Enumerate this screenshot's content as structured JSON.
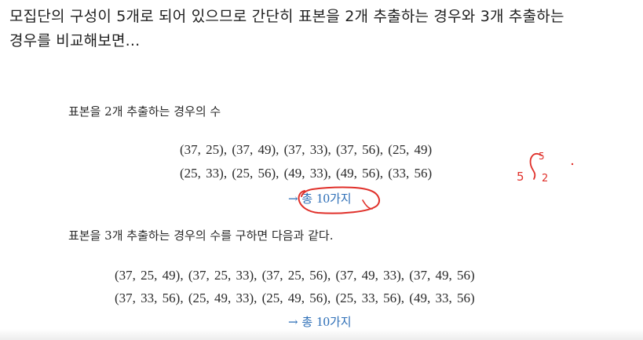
{
  "intro": {
    "line1": "모집단의 구성이 5개로 되어 있으므로 간단히 표본을 2개 추출하는 경우와 3개 추출하는",
    "line2": "경우를 비교해보면..."
  },
  "section_two": {
    "heading": "표본을 2개 추출하는 경우의 수",
    "rows": [
      "(37, 25), (37, 49), (37, 33), (37, 56), (25, 49)",
      "(25, 33), (25, 56), (49, 33), (49, 56), (33, 56)"
    ],
    "total_arrow": "→",
    "total_prefix": "총",
    "total_num": "10",
    "total_suffix": "가지"
  },
  "section_three": {
    "heading": "표본을 3개 추출하는 경우의 수를 구하면 다음과 같다.",
    "rows": [
      "(37, 25, 49), (37, 25, 33), (37, 25, 56), (37, 49, 33), (37, 49, 56)",
      "(37, 33, 56), (25, 49, 33), (25, 49, 56), (25, 33, 56), (49, 33, 56)"
    ],
    "total_arrow": "→",
    "total_prefix": "총",
    "total_num": "10",
    "total_suffix": "가지"
  },
  "annotation": {
    "ink_color": "#e0302a",
    "note_top": "5",
    "note_left": "5",
    "note_right": "2"
  }
}
